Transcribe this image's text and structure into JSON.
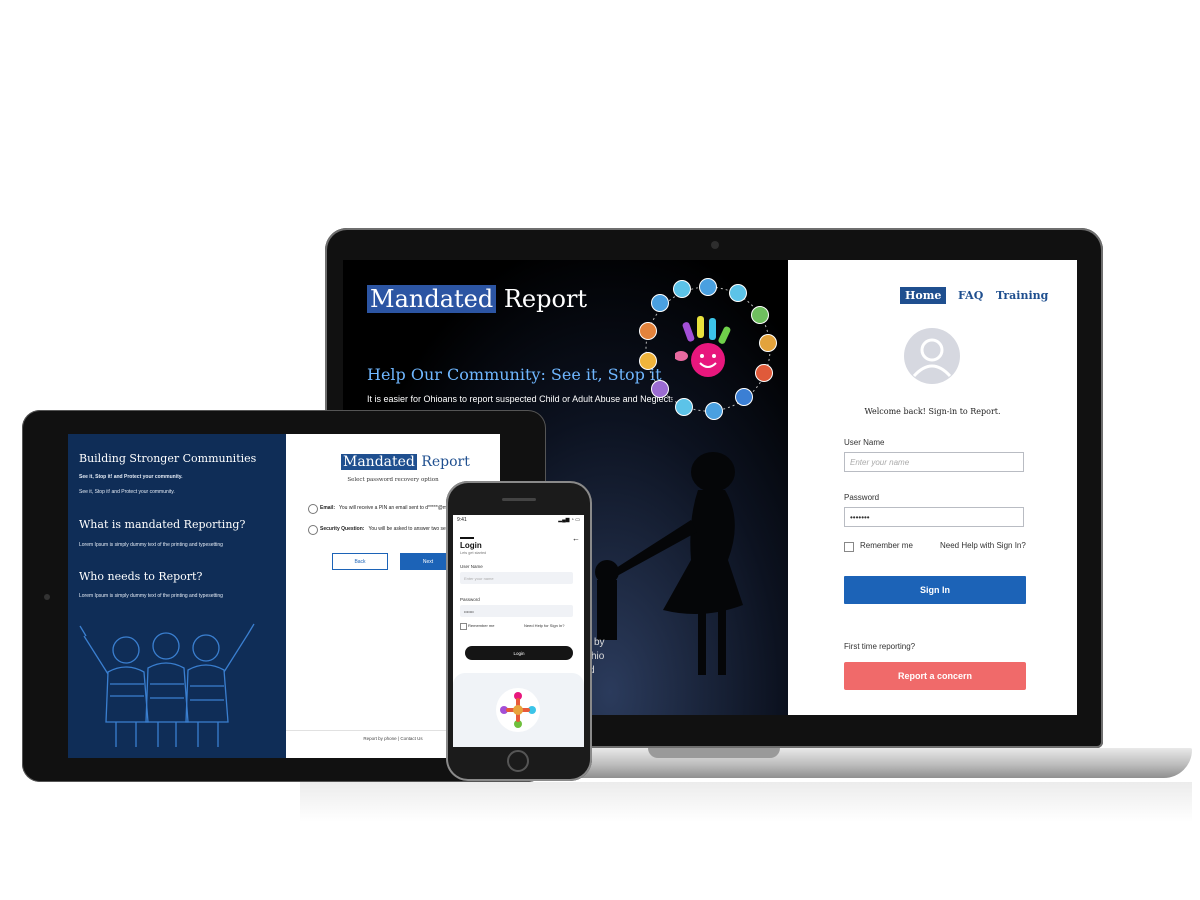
{
  "laptop": {
    "logo_hl": "Mandated",
    "logo_rest": " Report",
    "hero_title": "Help Our Community: See it, Stop it",
    "hero_sub": "It is easier for Ohioans to report suspected Child or Adult Abuse and Neglect:",
    "hero_frag1": "by",
    "hero_frag2": "hio",
    "hero_frag3": "d",
    "nav": {
      "home": "Home",
      "faq": "FAQ",
      "training": "Training"
    },
    "welcome": "Welcome back!  Sign-in to Report.",
    "username_label": "User Name",
    "username_placeholder": "Enter your name",
    "password_label": "Password",
    "password_value": "•••••••",
    "remember": "Remember me",
    "help": "Need Help with Sign In?",
    "sign_in": "Sign In",
    "first_time": "First time reporting?",
    "report_btn": "Report a concern"
  },
  "tablet": {
    "left_heading1": "Building Stronger Communities",
    "left_sub1a": "See it, Stop it! and Protect your community.",
    "left_sub1b": "See it, Stop it! and Protect your community.",
    "left_heading2": "What is mandated Reporting?",
    "left_sub2": "Lorem Ipsum is simply dummy text of the printing and typesetting",
    "left_heading3": "Who needs to Report?",
    "left_sub3": "Lorem Ipsum is simply dummy text of the printing and typesetting",
    "logo_hl": "Mandated",
    "logo_rest": " Report",
    "recovery_title": "Select password recovery option",
    "email_label": "Email:",
    "email_text": "You will receive a PIN an email sent to d*****@m",
    "security_label": "Security Question:",
    "security_text": "You will be asked to answer two sec",
    "back": "Back",
    "next": "Next",
    "footer": "Report by phone   |   Contact Us"
  },
  "phone": {
    "time": "9:41",
    "signal": "▂▄▆ ◔ ▭",
    "back_arrow": "←",
    "title": "Login",
    "subtitle": "Lets get started",
    "username_label": "User Name",
    "username_placeholder": "Enter your name",
    "password_label": "Password",
    "password_value": "•••••••",
    "remember": "Remember me",
    "help": "Need Help for Sign In?",
    "login_btn": "Login"
  },
  "colors": {
    "brand_blue": "#1f4f8f",
    "button_blue": "#1c63b7",
    "report_coral": "#f06a6a",
    "hero_text_blue": "#6fb7ff",
    "tablet_panel": "#0f2d57"
  }
}
